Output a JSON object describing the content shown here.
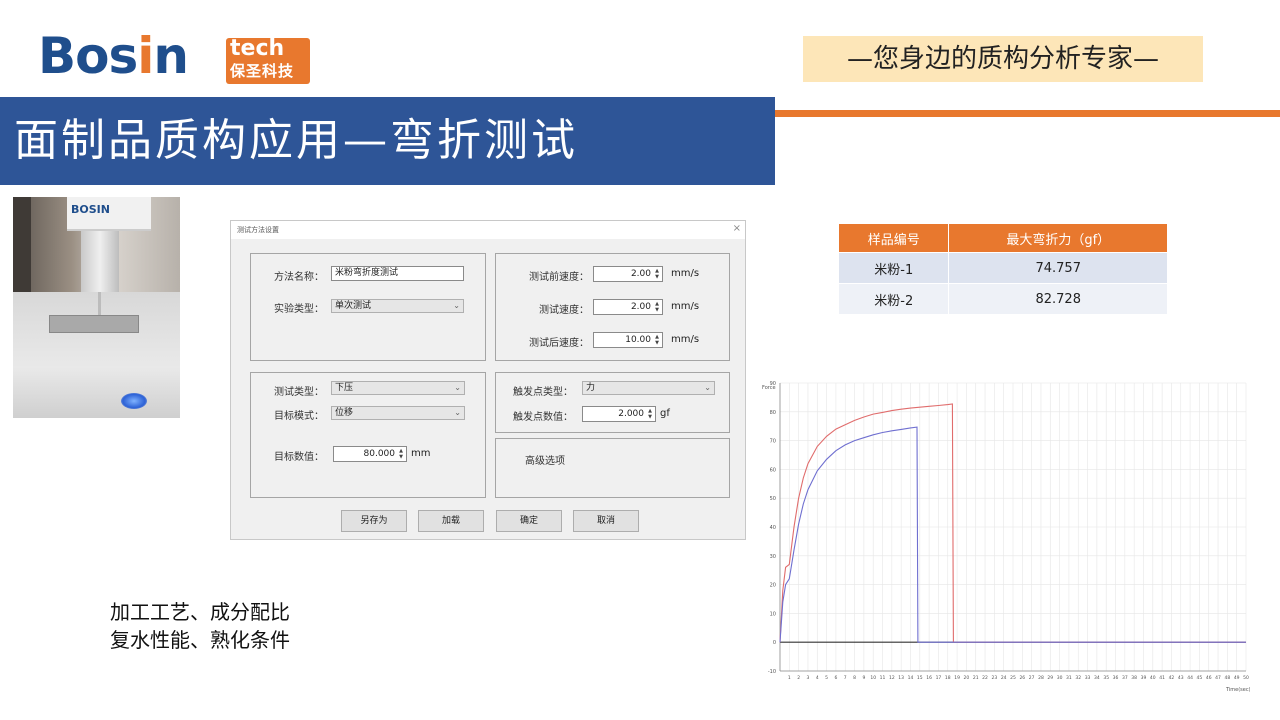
{
  "brand": {
    "logo_main_a": "Bos",
    "logo_main_b": "i",
    "logo_main_c": "n",
    "logo_tech": "tech",
    "logo_cn": "保圣科技",
    "slogan": "—您身边的质构分析专家—"
  },
  "slide_title": "面制品质构应用—弯折测试",
  "photo": {
    "machine_logo": "BOSIN"
  },
  "dialog": {
    "title": "测试方法设置",
    "close_icon": "×",
    "method_name_label": "方法名称：",
    "method_name_value": "米粉弯折度测试",
    "experiment_type_label": "实验类型：",
    "experiment_type_value": "单次测试",
    "pre_speed_label": "测试前速度：",
    "pre_speed_value": "2.00",
    "test_speed_label": "测试速度：",
    "test_speed_value": "2.00",
    "post_speed_label": "测试后速度：",
    "post_speed_value": "10.00",
    "speed_unit": "mm/s",
    "test_type_label": "测试类型：",
    "test_type_value": "下压",
    "target_mode_label": "目标模式：",
    "target_mode_value": "位移",
    "target_value_label": "目标数值：",
    "target_value_value": "80.000",
    "target_unit": "mm",
    "trigger_type_label": "触发点类型：",
    "trigger_type_value": "力",
    "trigger_value_label": "触发点数值：",
    "trigger_value_value": "2.000",
    "trigger_unit": "gf",
    "advanced_label": "高级选项",
    "buttons": {
      "save_as": "另存为",
      "load": "加载",
      "ok": "确定",
      "cancel": "取消"
    }
  },
  "results_table": {
    "headers": [
      "样品编号",
      "最大弯折力（gf）"
    ],
    "rows": [
      [
        "米粉-1",
        "74.757"
      ],
      [
        "米粉-2",
        "82.728"
      ]
    ]
  },
  "notes": {
    "line1": "加工工艺、成分配比",
    "line2": "复水性能、熟化条件"
  },
  "chart_data": {
    "type": "line",
    "ylabel": "Force",
    "xlabel": "Time(sec)",
    "xlim": [
      0,
      50
    ],
    "ylim": [
      -10,
      90
    ],
    "x_ticks": [
      1,
      2,
      3,
      4,
      5,
      6,
      7,
      8,
      9,
      10,
      11,
      12,
      13,
      14,
      15,
      16,
      17,
      18,
      19,
      20,
      21,
      22,
      23,
      24,
      25,
      26,
      27,
      28,
      29,
      30,
      31,
      32,
      33,
      34,
      35,
      36,
      37,
      38,
      39,
      40,
      41,
      42,
      43,
      44,
      45,
      46,
      47,
      48,
      49,
      50
    ],
    "y_ticks": [
      -10,
      0,
      10,
      20,
      30,
      40,
      50,
      60,
      70,
      80,
      90
    ],
    "grid": true,
    "series": [
      {
        "color": "#e06c6c",
        "x": [
          0,
          0.3,
          0.6,
          1,
          1.5,
          2,
          2.5,
          3,
          4,
          5,
          6,
          7,
          8,
          9,
          10,
          11,
          12,
          13,
          14,
          15,
          16,
          17,
          18,
          18.5,
          18.6,
          19,
          25,
          30,
          40,
          50
        ],
        "y": [
          0,
          18,
          26,
          27,
          40,
          50,
          57,
          62,
          68,
          71.5,
          74,
          75.5,
          77,
          78.2,
          79.2,
          79.8,
          80.4,
          80.9,
          81.3,
          81.6,
          81.9,
          82.2,
          82.5,
          82.7,
          0,
          0,
          0,
          0,
          0,
          0
        ]
      },
      {
        "color": "#6f6fd0",
        "x": [
          0,
          0.3,
          0.6,
          1,
          1.5,
          2,
          2.5,
          3,
          4,
          5,
          6,
          7,
          8,
          9,
          10,
          11,
          12,
          13,
          14,
          14.7,
          14.8,
          15,
          20,
          30,
          40,
          50
        ],
        "y": [
          0,
          14,
          20,
          22,
          32,
          41,
          48,
          53,
          59.5,
          63.5,
          66.5,
          68.5,
          70,
          71,
          72,
          72.8,
          73.4,
          73.9,
          74.4,
          74.7,
          0,
          0,
          0,
          0,
          0,
          0
        ]
      }
    ]
  }
}
